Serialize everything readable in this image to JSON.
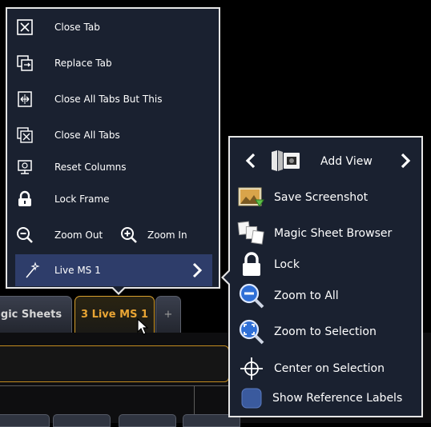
{
  "left_menu": {
    "items": [
      {
        "label": "Close Tab",
        "icon": "close-tab-icon"
      },
      {
        "label": "Replace Tab",
        "icon": "replace-tab-icon"
      },
      {
        "label": "Close All Tabs But This",
        "icon": "close-others-icon"
      },
      {
        "label": "Close All Tabs",
        "icon": "close-all-tabs-icon"
      },
      {
        "label": "Reset Columns",
        "icon": "reset-columns-icon"
      },
      {
        "label": "Lock Frame",
        "icon": "lock-icon"
      }
    ],
    "zoom_out_label": "Zoom Out",
    "zoom_in_label": "Zoom In",
    "live_ms_label": "Live MS 1"
  },
  "right_menu": {
    "add_view_label": "Add View",
    "items": [
      {
        "label": "Save Screenshot",
        "icon": "screenshot-icon"
      },
      {
        "label": "Magic Sheet Browser",
        "icon": "magic-sheet-browser-icon"
      },
      {
        "label": "Lock",
        "icon": "lock-icon"
      },
      {
        "label": "Zoom to All",
        "icon": "zoom-to-all-icon"
      },
      {
        "label": "Zoom to Selection",
        "icon": "zoom-to-selection-icon"
      },
      {
        "label": "Center on Selection",
        "icon": "crosshair-icon"
      },
      {
        "label": "Show Reference Labels",
        "icon": "checkbox-icon"
      }
    ]
  },
  "tabs": {
    "magic_sheets": "gic Sheets",
    "live_ms": "3 Live MS 1",
    "add": "+"
  },
  "colors": {
    "menu_bg": "#1a2130",
    "menu_border": "#e6e6e6",
    "highlight": "#2e3d6a",
    "active_tab": "#e9a534"
  }
}
